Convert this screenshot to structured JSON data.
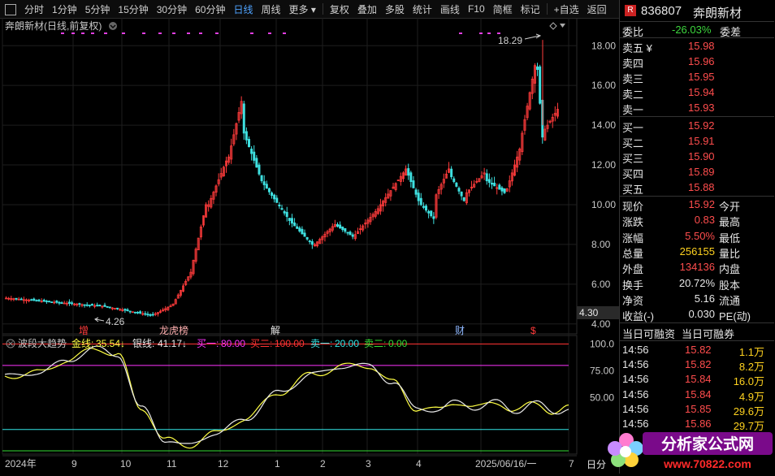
{
  "toolbar": {
    "items": [
      "分时",
      "1分钟",
      "5分钟",
      "15分钟",
      "30分钟",
      "60分钟",
      "日线",
      "周线",
      "更多 ▾",
      "复权",
      "叠加",
      "多股",
      "统计",
      "画线",
      "F10",
      "简框",
      "标记",
      "+自选",
      "返回"
    ],
    "active": "日线"
  },
  "stock": {
    "title": "奔朗新材(日线,前复权)",
    "code": "836807",
    "name": "奔朗新材",
    "high_label": "18.29",
    "low_label": "4.26",
    "price_marker": "4.30",
    "event_labels": [
      "增",
      "龙虎榜",
      "解",
      "财",
      "$"
    ]
  },
  "indicator": {
    "name": "波段大趋势",
    "gold_label": "金线:",
    "gold_value": "35.54↓",
    "silver_label": "银线:",
    "silver_value": "41.17↓",
    "buy1_label": "买一:",
    "buy1_value": "80.00",
    "buy2_label": "买二:",
    "buy2_value": "100.00",
    "sell1_label": "卖一:",
    "sell1_value": "20.00",
    "sell2_label": "卖二:",
    "sell2_value": "0.00"
  },
  "chart_data": [
    {
      "type": "candlestick",
      "title": "奔朗新材(日线,前复权)",
      "y_ticks": [
        "18.00",
        "16.00",
        "14.00",
        "12.00",
        "10.00",
        "8.00",
        "6.00",
        "4.00"
      ],
      "ylim": [
        3.5,
        19.4
      ],
      "x_ticks": [
        "2024年",
        "9",
        "10",
        "11",
        "12",
        "1",
        "2",
        "3",
        "4",
        "2025/06/16/一",
        "7"
      ],
      "annotations": [
        "18.29",
        "4.26"
      ]
    },
    {
      "type": "line",
      "title": "波段大趋势",
      "y_ticks": [
        "100.0",
        "75.00",
        "50.00"
      ],
      "ylim": [
        -3,
        108
      ],
      "series": [
        {
          "name": "金线",
          "color": "#ffff44"
        },
        {
          "name": "银线",
          "color": "#e8e8e8"
        },
        {
          "name": "买一",
          "color": "#ff33ff",
          "value": 80
        },
        {
          "name": "买二",
          "color": "#ff3333",
          "value": 100
        },
        {
          "name": "卖一",
          "color": "#33e6e6",
          "value": 20
        },
        {
          "name": "卖二",
          "color": "#33dd33",
          "value": 0
        }
      ]
    }
  ],
  "quote": {
    "weibi_label": "委比",
    "weibi_value": "-26.03%",
    "weicha_label": "委差",
    "asks": [
      {
        "label": "卖五 ¥",
        "price": "15.98"
      },
      {
        "label": "卖四",
        "price": "15.96"
      },
      {
        "label": "卖三",
        "price": "15.95"
      },
      {
        "label": "卖二",
        "price": "15.94"
      },
      {
        "label": "卖一",
        "price": "15.93"
      }
    ],
    "bids": [
      {
        "label": "买一",
        "price": "15.92"
      },
      {
        "label": "买二",
        "price": "15.91"
      },
      {
        "label": "买三",
        "price": "15.90"
      },
      {
        "label": "买四",
        "price": "15.89"
      },
      {
        "label": "买五",
        "price": "15.88"
      }
    ],
    "stats": [
      {
        "l1": "现价",
        "v1": "15.92",
        "c1": "red",
        "l2": "今开"
      },
      {
        "l1": "涨跌",
        "v1": "0.83",
        "c1": "red",
        "l2": "最高"
      },
      {
        "l1": "涨幅",
        "v1": "5.50%",
        "c1": "red",
        "l2": "最低"
      },
      {
        "l1": "总量",
        "v1": "256155",
        "c1": "yellow",
        "l2": "量比"
      },
      {
        "l1": "外盘",
        "v1": "134136",
        "c1": "red",
        "l2": "内盘"
      },
      {
        "l1": "换手",
        "v1": "20.72%",
        "c1": "white",
        "l2": "股本"
      },
      {
        "l1": "净资",
        "v1": "5.16",
        "c1": "white",
        "l2": "流通"
      },
      {
        "l1": "收益(-)",
        "v1": "0.030",
        "c1": "white",
        "l2": "PE(动)"
      }
    ],
    "margin_left": "当日可融资",
    "margin_right": "当日可融券",
    "ticks": [
      {
        "time": "14:56",
        "price": "15.82",
        "vol": "1.1万"
      },
      {
        "time": "14:56",
        "price": "15.82",
        "vol": "8.2万"
      },
      {
        "time": "14:56",
        "price": "15.84",
        "vol": "16.0万"
      },
      {
        "time": "14:56",
        "price": "15.84",
        "vol": "4.9万"
      },
      {
        "time": "14:56",
        "price": "15.85",
        "vol": "29.6万"
      },
      {
        "time": "14:56",
        "price": "15.86",
        "vol": "29.7万"
      }
    ],
    "bottom_label": "日分"
  },
  "watermark": {
    "text": "分析家公式网",
    "url": "www.70822.com"
  }
}
